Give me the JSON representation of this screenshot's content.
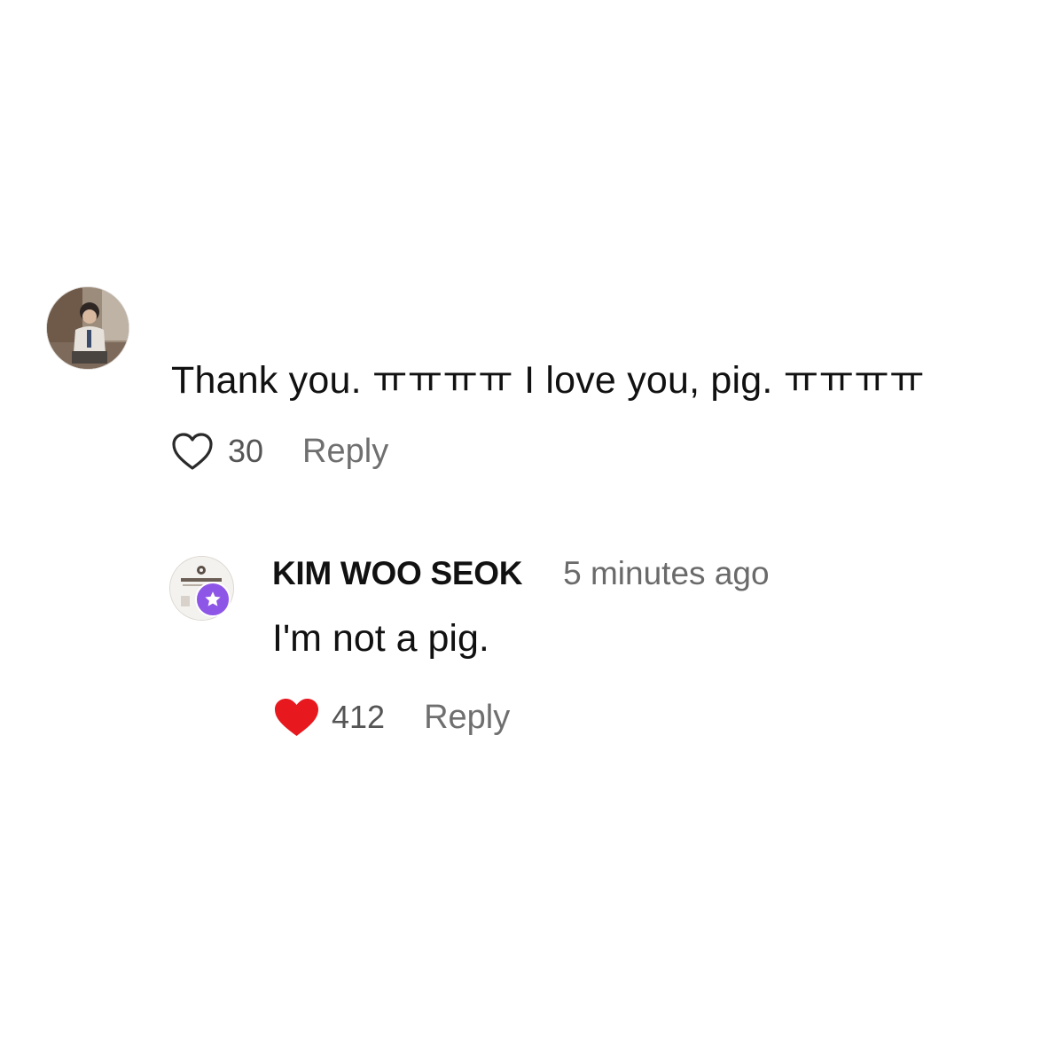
{
  "comments": [
    {
      "avatar_icon": "user-photo-avatar",
      "text": "Thank you. ㅠㅠㅠㅠ I love you, pig. ㅠㅠㅠㅠ",
      "like_icon": "heart-outline-icon",
      "likes": "30",
      "reply_label": "Reply"
    }
  ],
  "reply": {
    "avatar_icon": "channel-logo-avatar",
    "badge_icon": "star-badge-icon",
    "badge_color": "#8e56e6",
    "author": "KIM WOO SEOK",
    "timestamp": "5 minutes ago",
    "text": "I'm not a pig.",
    "like_icon": "heart-filled-icon",
    "like_color": "#e8181f",
    "likes": "412",
    "reply_label": "Reply"
  }
}
